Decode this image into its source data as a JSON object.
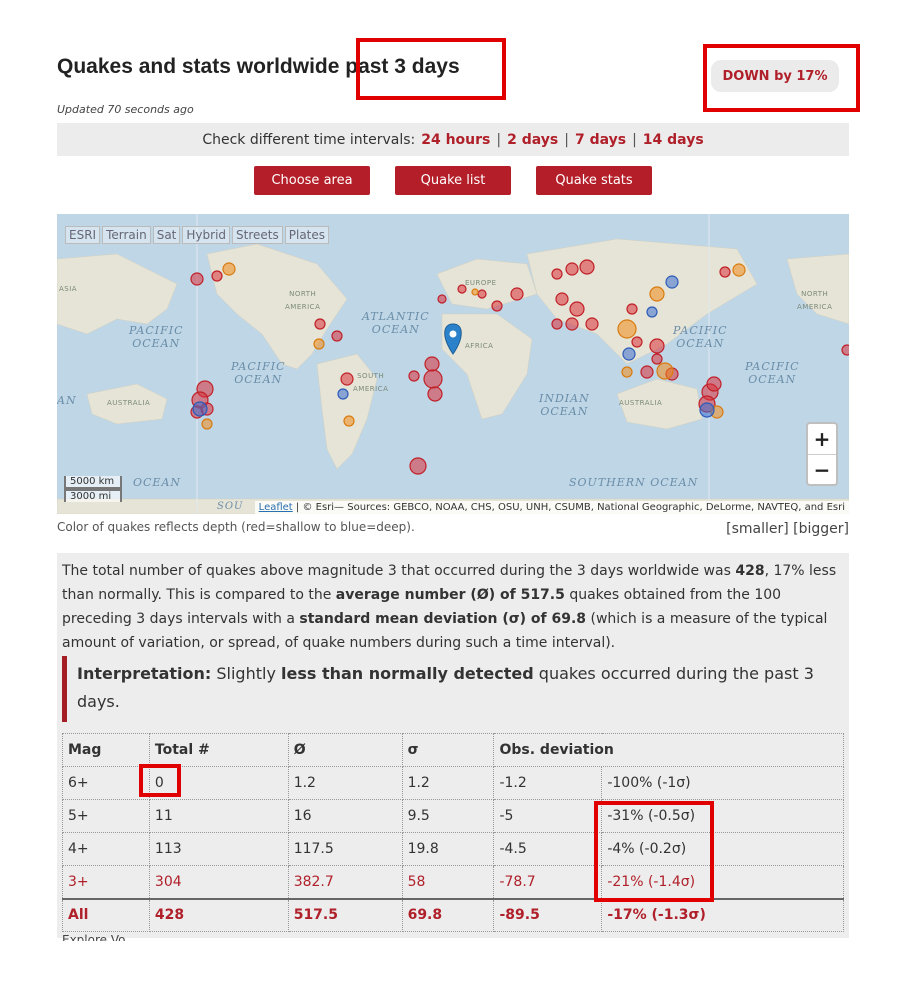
{
  "header": {
    "title": "Quakes and stats worldwide past 3 days",
    "updated": "Updated 70 seconds ago",
    "badge": "DOWN by 17%"
  },
  "intervals": {
    "prefix": "Check different time intervals:",
    "links": [
      "24 hours",
      "2 days",
      "7 days",
      "14 days"
    ],
    "separator": "|"
  },
  "buttons": {
    "choose_area": "Choose area",
    "quake_list": "Quake list",
    "quake_stats": "Quake stats"
  },
  "map": {
    "layers": [
      "ESRI",
      "Terrain",
      "Sat",
      "Hybrid",
      "Streets",
      "Plates"
    ],
    "labels": {
      "atlantic": "ATLANTIC\nOCEAN",
      "pacific_w": "PACIFIC\nOCEAN",
      "pacific_mid": "PACIFIC\nOCEAN",
      "pacific_e": "PACIFIC\nOCEAN",
      "pacific_ne": "PACIFIC\nOCEAN",
      "indian": "INDIAN\nOCEAN",
      "southern": "SOUTHERN OCEAN",
      "ocean_sw": "OCEAN",
      "asia": "ASIA",
      "north_america_w": "NORTH\nAMERICA",
      "north_america_e": "NORTH\nAMERICA",
      "europe": "EUROPE",
      "africa": "AFRICA",
      "south_america": "SOUTH\nAMERICA",
      "australia_w": "AUSTRALIA",
      "australia_e": "AUSTRALIA",
      "an_left": "AN",
      "sou": "SOU"
    },
    "zoom_in": "+",
    "zoom_out": "−",
    "scale_km": "5000 km",
    "scale_mi": "3000 mi",
    "attrib_link": "Leaflet",
    "attrib_text": " | © Esri— Sources: GEBCO, NOAA, CHS, OSU, UNH, CSUMB, National Geographic, DeLorme, NAVTEQ, and Esri",
    "colors": {
      "shallow": "#d9323a",
      "mid": "#f08a1a",
      "deep": "#3d6fd1",
      "marker": "#2b82cb",
      "land": "#e6e4d6",
      "sea": "#bfd6e6"
    }
  },
  "depth_note": "Color of quakes reflects depth (red=shallow to blue=deep).",
  "sizes": {
    "smaller": "[smaller]",
    "bigger": "[bigger]"
  },
  "stats": {
    "p1": "The total number of quakes above magnitude 3 that occurred during the 3 days worldwide was ",
    "total": "428",
    "p2": ", 17% less than normally. This is compared to the ",
    "avg_label": "average number (Ø) of 517.5",
    "p3": " quakes obtained from the 100 preceding 3 days intervals with a ",
    "sd_label": "standard mean deviation (σ) of 69.8",
    "p4": " (which is a measure of the typical amount of variation, or spread, of quake numbers during such a time interval).",
    "interp_label": "Interpretation:",
    "interp_pre": " Slightly ",
    "interp_bold": "less than normally detected",
    "interp_post": " quakes occurred during the past 3 days."
  },
  "table": {
    "headers": [
      "Mag",
      "Total #",
      "Ø",
      "σ",
      "Obs. deviation"
    ],
    "rows": [
      [
        "6+",
        "0",
        "1.2",
        "1.2",
        "-1.2",
        "-100% (-1σ)"
      ],
      [
        "5+",
        "11",
        "16",
        "9.5",
        "-5",
        "-31% (-0.5σ)"
      ],
      [
        "4+",
        "113",
        "117.5",
        "19.8",
        "-4.5",
        "-4% (-0.2σ)"
      ],
      [
        "3+",
        "304",
        "382.7",
        "58",
        "-78.7",
        "-21% (-1.4σ)"
      ],
      [
        "All",
        "428",
        "517.5",
        "69.8",
        "-89.5",
        "-17% (-1.3σ)"
      ]
    ]
  },
  "trailing_text": "Explore Vo"
}
